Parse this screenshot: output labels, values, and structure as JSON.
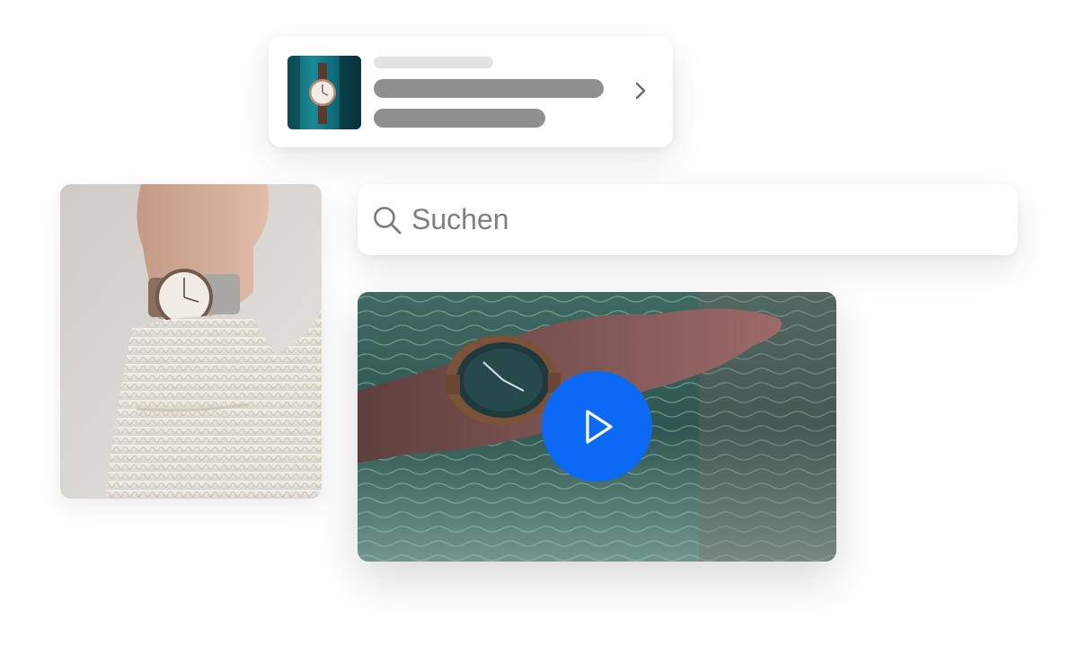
{
  "search": {
    "placeholder": "Suchen",
    "icon": "search-icon"
  },
  "product_card": {
    "icon": "chevron-right-icon"
  },
  "video": {
    "play_icon": "play-icon"
  },
  "colors": {
    "accent": "#0a6af5",
    "skeleton_dark": "#8f8f8f",
    "skeleton_light": "#e3e3e3",
    "placeholder_text": "#808080"
  }
}
